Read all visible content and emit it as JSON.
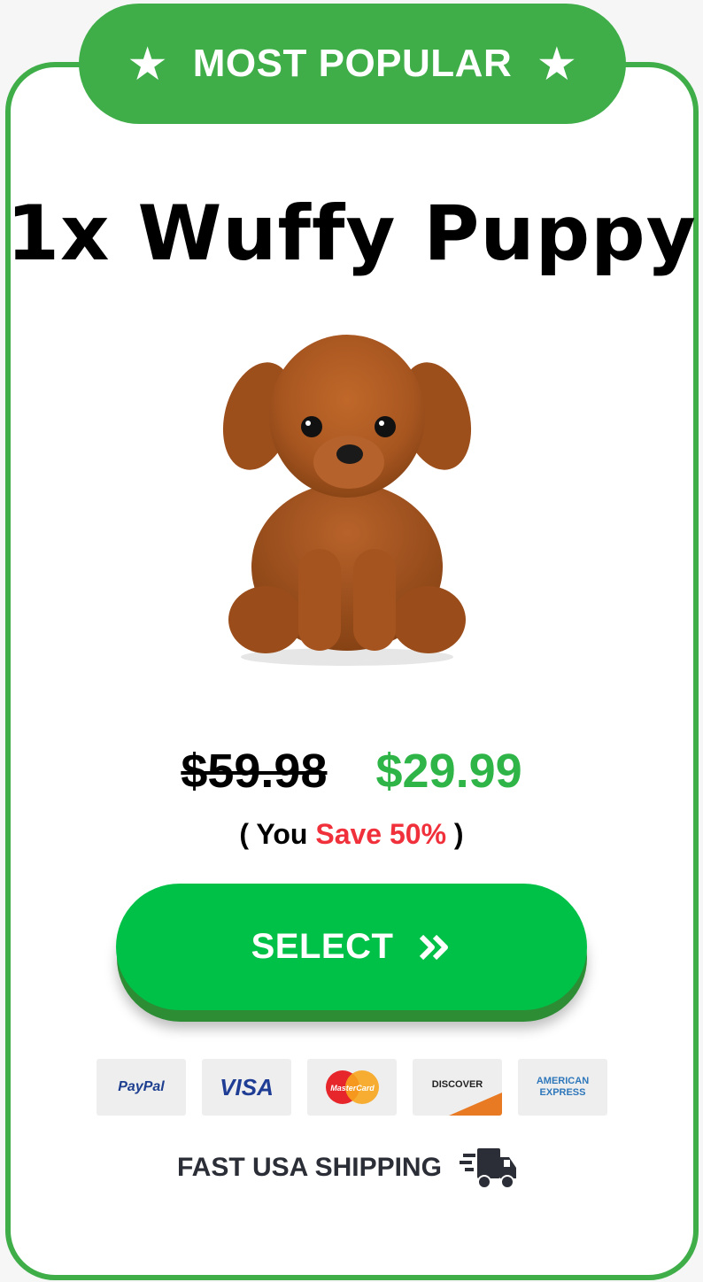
{
  "badge": {
    "label": "MOST POPULAR",
    "star": "★"
  },
  "product": {
    "title": "1x Wuffy Puppy",
    "image": "plush-puppy-image"
  },
  "pricing": {
    "old_price": "$59.98",
    "new_price": "$29.99",
    "save_open": "( You ",
    "save_text": "Save 50%",
    "save_close": " )"
  },
  "cta": {
    "label": "SELECT",
    "icon": "double-chevron-right-icon"
  },
  "payments": [
    "PayPal",
    "VISA",
    "MasterCard",
    "DISCOVER",
    "AMERICAN EXPRESS"
  ],
  "shipping": {
    "label": "FAST USA SHIPPING",
    "icon": "delivery-truck-icon"
  },
  "colors": {
    "brand_green": "#3fae49",
    "button_green": "#00c148",
    "price_green": "#2fb547",
    "save_red": "#f0303a"
  }
}
